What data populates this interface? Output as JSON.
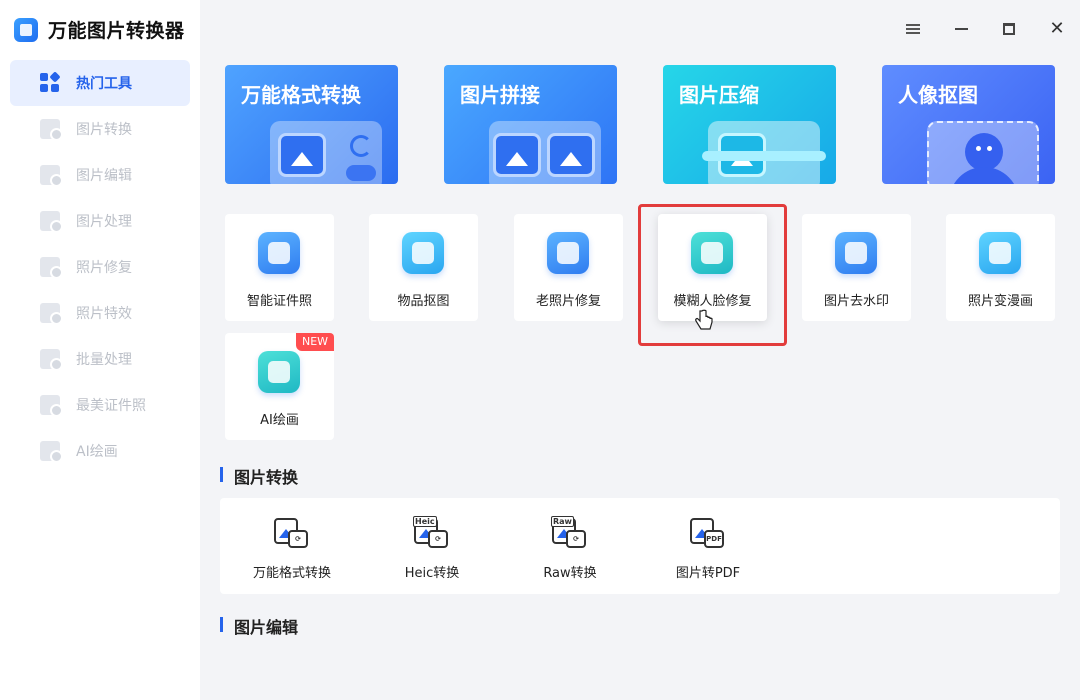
{
  "app": {
    "title": "万能图片转换器"
  },
  "sidebar": {
    "items": [
      {
        "label": "热门工具",
        "active": true
      },
      {
        "label": "图片转换"
      },
      {
        "label": "图片编辑"
      },
      {
        "label": "图片处理"
      },
      {
        "label": "照片修复"
      },
      {
        "label": "照片特效"
      },
      {
        "label": "批量处理"
      },
      {
        "label": "最美证件照"
      },
      {
        "label": "AI绘画"
      }
    ]
  },
  "hero_cards": [
    {
      "label": "万能格式转换"
    },
    {
      "label": "图片拼接"
    },
    {
      "label": "图片压缩"
    },
    {
      "label": "人像抠图"
    }
  ],
  "tools": [
    {
      "label": "智能证件照"
    },
    {
      "label": "物品抠图"
    },
    {
      "label": "老照片修复"
    },
    {
      "label": "模糊人脸修复",
      "highlighted": true
    },
    {
      "label": "图片去水印"
    },
    {
      "label": "照片变漫画"
    },
    {
      "label": "AI绘画",
      "badge": "NEW"
    }
  ],
  "sections": {
    "convert": {
      "title": "图片转换",
      "items": [
        {
          "label": "万能格式转换"
        },
        {
          "label": "Heic转换",
          "tag": "Heic"
        },
        {
          "label": "Raw转换",
          "tag": "Raw"
        },
        {
          "label": "图片转PDF",
          "badge": "PDF"
        }
      ]
    },
    "edit": {
      "title": "图片编辑"
    }
  },
  "colors": {
    "accent": "#2563eb",
    "highlight_border": "#e23c3c",
    "new_badge": "#ff4d4f"
  }
}
